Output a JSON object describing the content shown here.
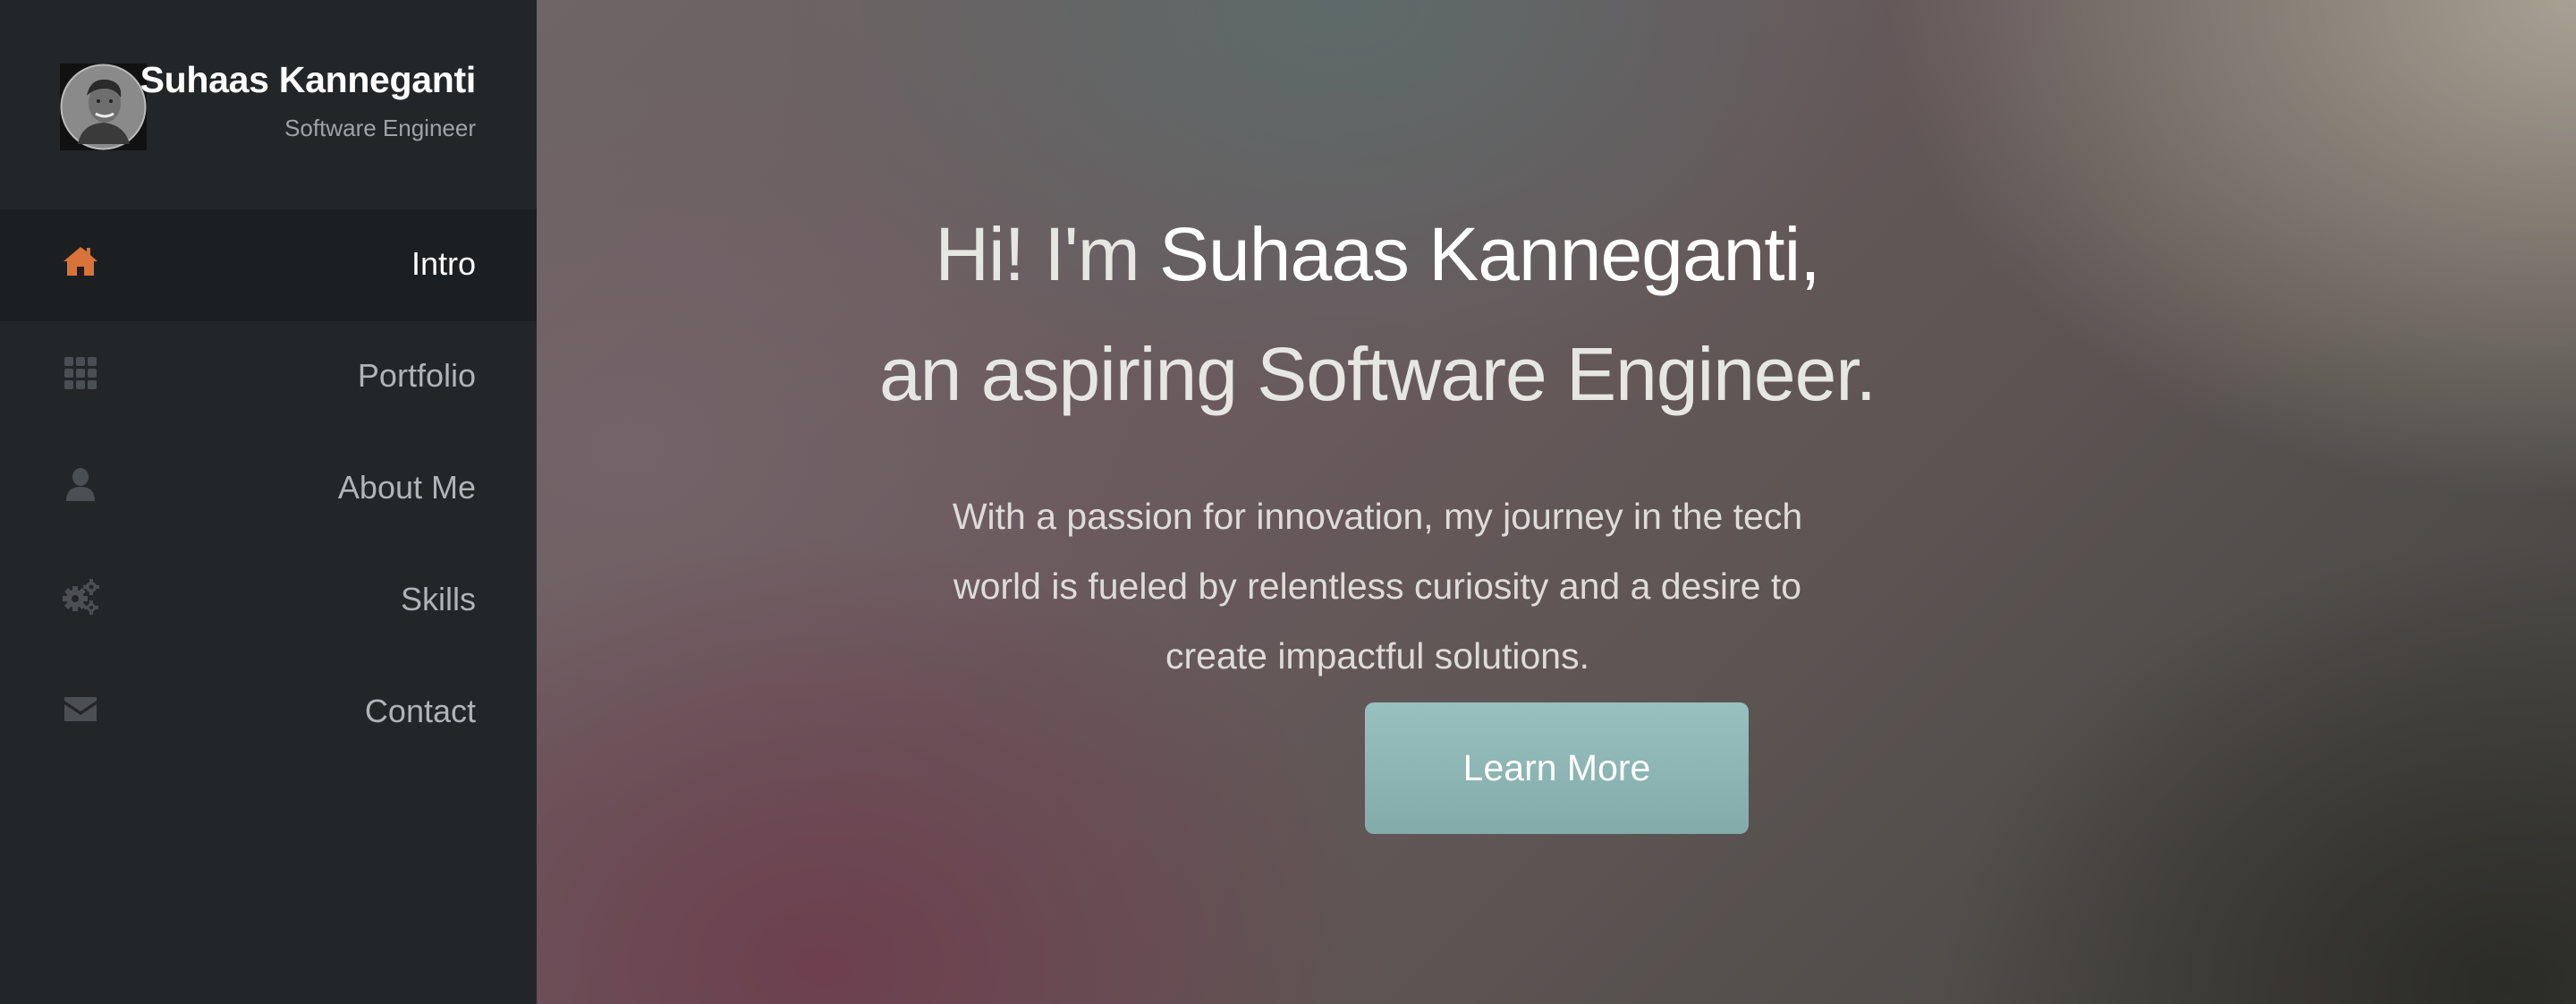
{
  "profile": {
    "name": "Suhaas Kanneganti",
    "role": "Software Engineer",
    "avatar_icon": "profile-photo"
  },
  "nav": {
    "items": [
      {
        "label": "Intro",
        "icon": "home-icon",
        "active": true
      },
      {
        "label": "Portfolio",
        "icon": "grid-icon",
        "active": false
      },
      {
        "label": "About Me",
        "icon": "user-icon",
        "active": false
      },
      {
        "label": "Skills",
        "icon": "gears-icon",
        "active": false
      },
      {
        "label": "Contact",
        "icon": "envelope-icon",
        "active": false
      }
    ]
  },
  "hero": {
    "greeting": "Hi! I'm",
    "name": "Suhaas Kanneganti,",
    "subtitle": "an aspiring Software Engineer.",
    "tagline": "With a passion for innovation, my journey in the tech world is fueled by relentless curiosity and a desire to create impactful solutions.",
    "button_label": "Learn More"
  },
  "colors": {
    "sidebar_bg": "#222629",
    "active_item_bg": "#1c1f22",
    "active_icon": "#d9733a",
    "inactive_icon": "#4a4f54",
    "button_bg": "#8fb8b6"
  }
}
